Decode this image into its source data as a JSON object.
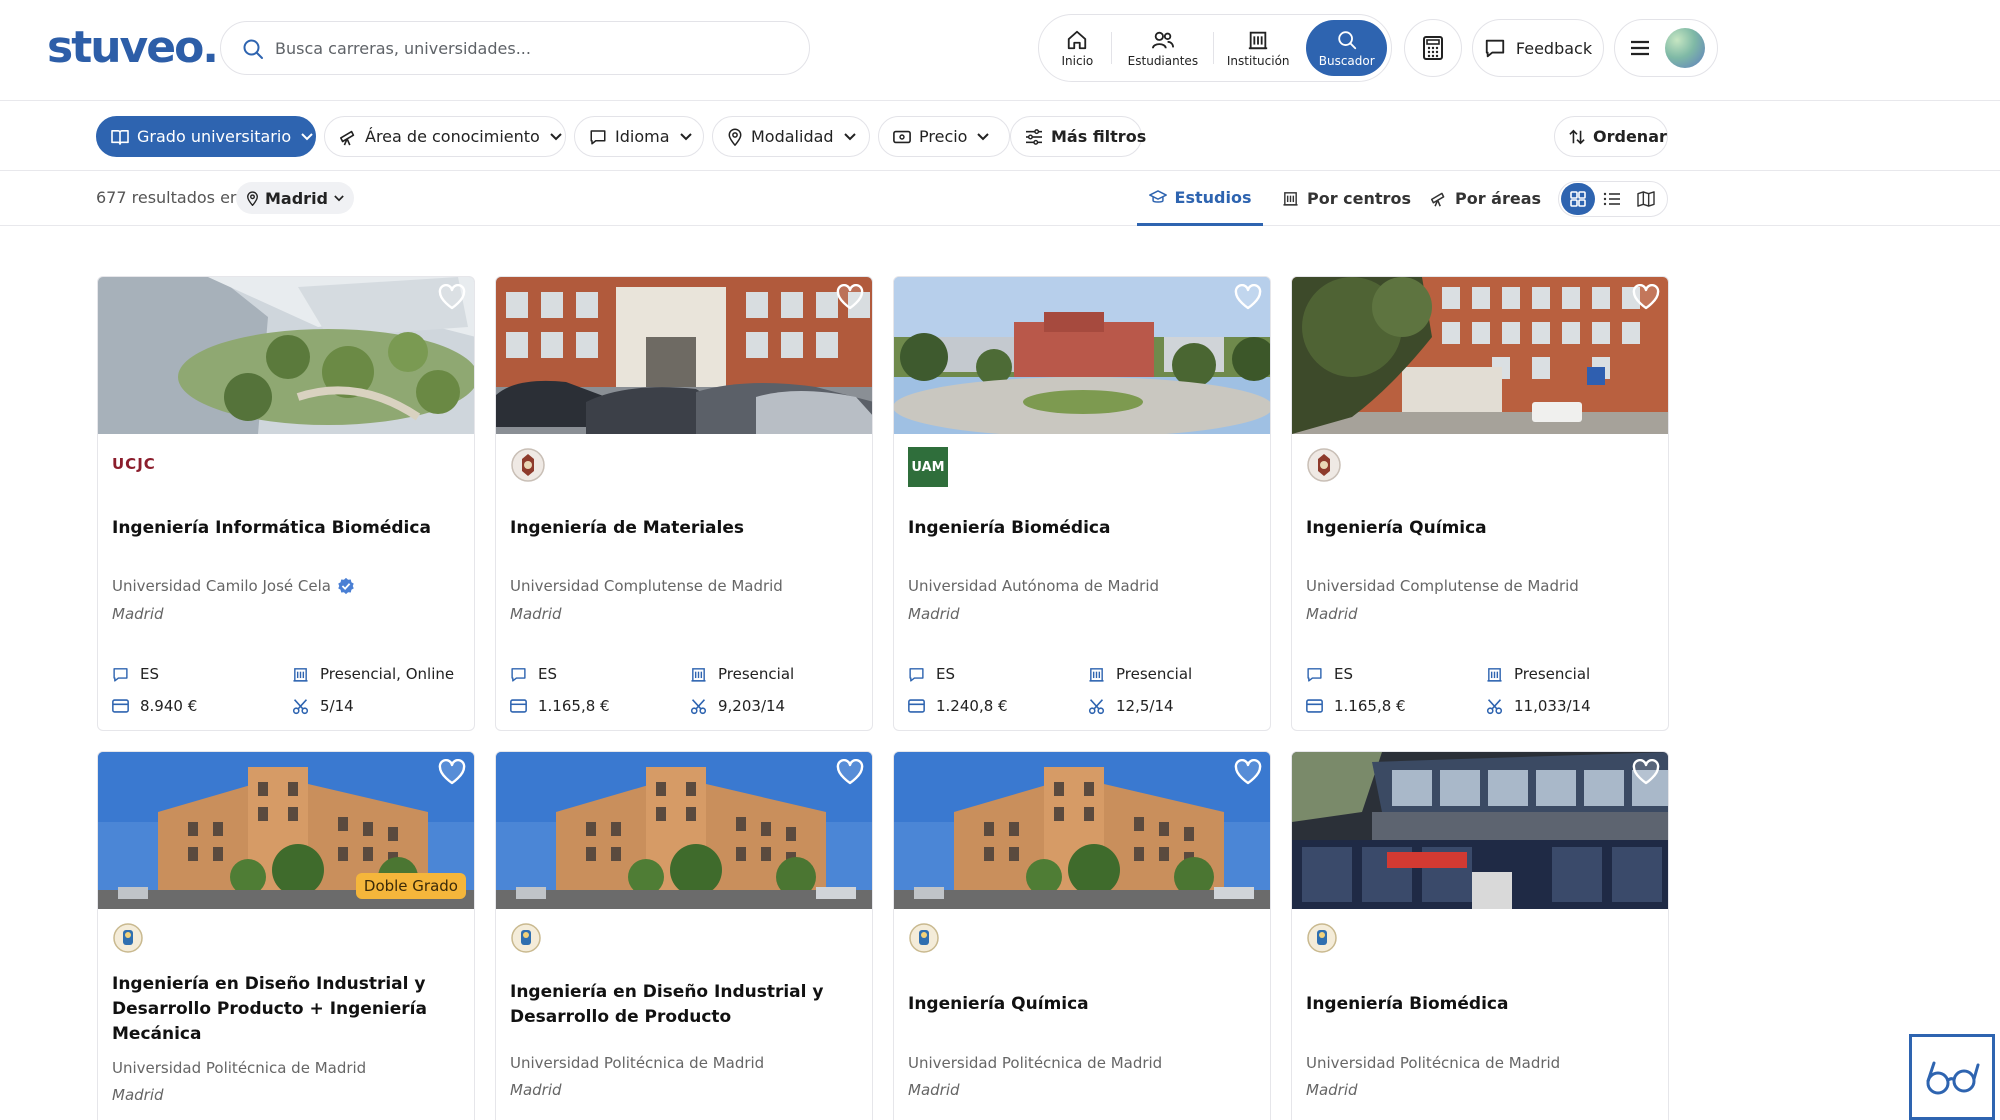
{
  "header": {
    "logo": "stuveo.",
    "search_placeholder": "Busca carreras, universidades...",
    "nav": [
      {
        "label": "Inicio",
        "icon": "home-icon"
      },
      {
        "label": "Estudiantes",
        "icon": "users-icon"
      },
      {
        "label": "Institución",
        "icon": "building-icon"
      },
      {
        "label": "Buscador",
        "icon": "search-icon",
        "active": true
      }
    ],
    "feedback_label": "Feedback"
  },
  "filters": {
    "grado": "Grado universitario",
    "area": "Área de conocimiento",
    "idioma": "Idioma",
    "modalidad": "Modalidad",
    "precio": "Precio",
    "mas_filtros": "Más filtros",
    "ordenar": "Ordenar"
  },
  "results": {
    "count_text": "677 resultados en",
    "location": "Madrid",
    "tabs": {
      "estudios": "Estudios",
      "centros": "Por centros",
      "areas": "Por áreas"
    }
  },
  "cards": [
    {
      "title": "Ingeniería Informática Biomédica",
      "university": "Universidad Camilo José Cela",
      "verified": true,
      "city": "Madrid",
      "language": "ES",
      "modality": "Presencial, Online",
      "price": "8.940 €",
      "cutoff": "5/14",
      "logo_text": "UCJC",
      "badge": ""
    },
    {
      "title": "Ingeniería de Materiales",
      "university": "Universidad Complutense de Madrid",
      "city": "Madrid",
      "language": "ES",
      "modality": "Presencial",
      "price": "1.165,8 €",
      "cutoff": "9,203/14",
      "badge": ""
    },
    {
      "title": "Ingeniería Biomédica",
      "university": "Universidad Autónoma de Madrid",
      "city": "Madrid",
      "language": "ES",
      "modality": "Presencial",
      "price": "1.240,8 €",
      "cutoff": "12,5/14",
      "logo_text": "UAM",
      "badge": ""
    },
    {
      "title": "Ingeniería Química",
      "university": "Universidad Complutense de Madrid",
      "city": "Madrid",
      "language": "ES",
      "modality": "Presencial",
      "price": "1.165,8 €",
      "cutoff": "11,033/14",
      "badge": ""
    },
    {
      "title": "Ingeniería en Diseño Industrial y Desarrollo Producto + Ingeniería Mecánica",
      "university": "Universidad Politécnica de Madrid",
      "city": "Madrid",
      "badge": "Doble Grado"
    },
    {
      "title": "Ingeniería en Diseño Industrial y Desarrollo de Producto",
      "university": "Universidad Politécnica de Madrid",
      "city": "Madrid",
      "badge": ""
    },
    {
      "title": "Ingeniería Química",
      "university": "Universidad Politécnica de Madrid",
      "city": "Madrid",
      "badge": ""
    },
    {
      "title": "Ingeniería Biomédica",
      "university": "Universidad Politécnica de Madrid",
      "city": "Madrid",
      "badge": ""
    }
  ],
  "colors": {
    "brand": "#2e64b0",
    "badge": "#f5b63b"
  }
}
